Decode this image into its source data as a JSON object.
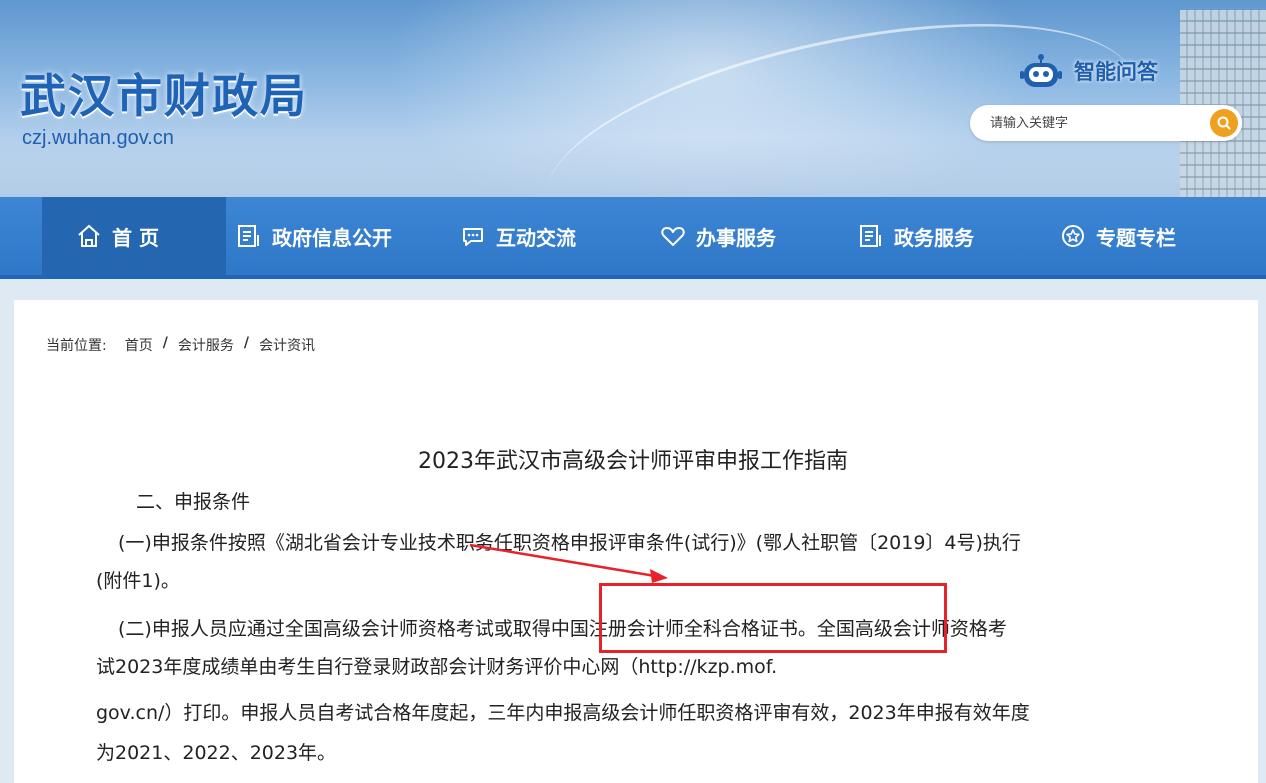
{
  "header": {
    "site_title": "武汉市财政局",
    "site_url": "czj.wuhan.gov.cn",
    "ai_qa_label": "智能问答",
    "search_placeholder": "请输入关键字"
  },
  "nav": {
    "items": [
      {
        "label": "首 页",
        "icon": "home-icon"
      },
      {
        "label": "政府信息公开",
        "icon": "document-icon"
      },
      {
        "label": "互动交流",
        "icon": "chat-icon"
      },
      {
        "label": "办事服务",
        "icon": "heart-icon"
      },
      {
        "label": "政务服务",
        "icon": "document-icon"
      },
      {
        "label": "专题专栏",
        "icon": "star-icon"
      }
    ]
  },
  "breadcrumb": {
    "prefix": "当前位置:",
    "items": [
      "首页",
      "会计服务",
      "会计资讯"
    ],
    "separator": "/"
  },
  "article": {
    "title": "2023年武汉市高级会计师评审申报工作指南",
    "section": "二、申报条件",
    "p1_line1": "(一)申报条件按照《湖北省会计专业技术职务任职资格申报评审条件(试行)》(鄂人社职管〔2019〕4号)执行",
    "p1_line2": "(附件1)。",
    "p2_line1": "(二)申报人员应通过全国高级会计师资格考试或取得中国注册会计师全科合格证书。全国高级会计师资格考",
    "p2_line2": "试2023年度成绩单由考生自行登录财政部会计财务评价中心网（http://kzp.mof.",
    "p2_line3": "gov.cn/）打印。申报人员自考试合格年度起，三年内申报高级会计师任职资格评审有效，2023年申报有效年度",
    "p2_line4": "为2021、2022、2023年。"
  },
  "annotation": {
    "box_color": "#e8222a",
    "arrow_color": "#e8222a"
  },
  "colors": {
    "brand_blue": "#1f63b6",
    "nav_blue": "#2f78c8",
    "search_orange": "#f0a020"
  }
}
